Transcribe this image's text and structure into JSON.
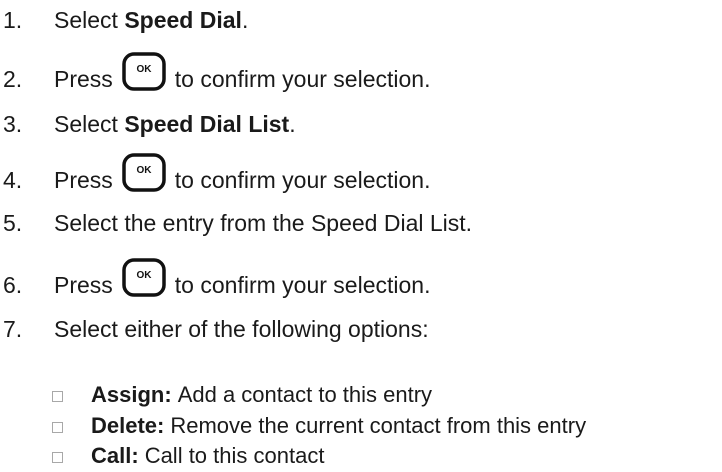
{
  "steps": [
    {
      "number": "1.",
      "text": "Select ",
      "bold": "Speed Dial",
      "after": "."
    },
    {
      "number": "2.",
      "before": "Press",
      "button": "OK",
      "after": "to confirm your selection."
    },
    {
      "number": "3.",
      "text": "Select ",
      "bold": "Speed Dial List",
      "after": "."
    },
    {
      "number": "4.",
      "before": "Press",
      "button": "OK",
      "after": "to confirm your selection."
    },
    {
      "number": "5.",
      "text": "Select the entry from the Speed Dial List."
    },
    {
      "number": "6.",
      "before": "Press",
      "button": "OK",
      "after": "to confirm your selection."
    },
    {
      "number": "7.",
      "text": "Select either of the following options:"
    }
  ],
  "options": [
    {
      "label": "Assign:",
      "description": "Add a contact to this entry"
    },
    {
      "label": "Delete:",
      "description": "Remove the current contact from this entry"
    },
    {
      "label": "Call:",
      "description": "Call to this contact"
    }
  ],
  "icons": {
    "ok_button": "ok-key-icon",
    "bullet": "checkbox-bullet-icon"
  },
  "colors": {
    "text": "#1a1a1a",
    "button_border": "#111111",
    "bullet_border": "#a8a8a8"
  }
}
